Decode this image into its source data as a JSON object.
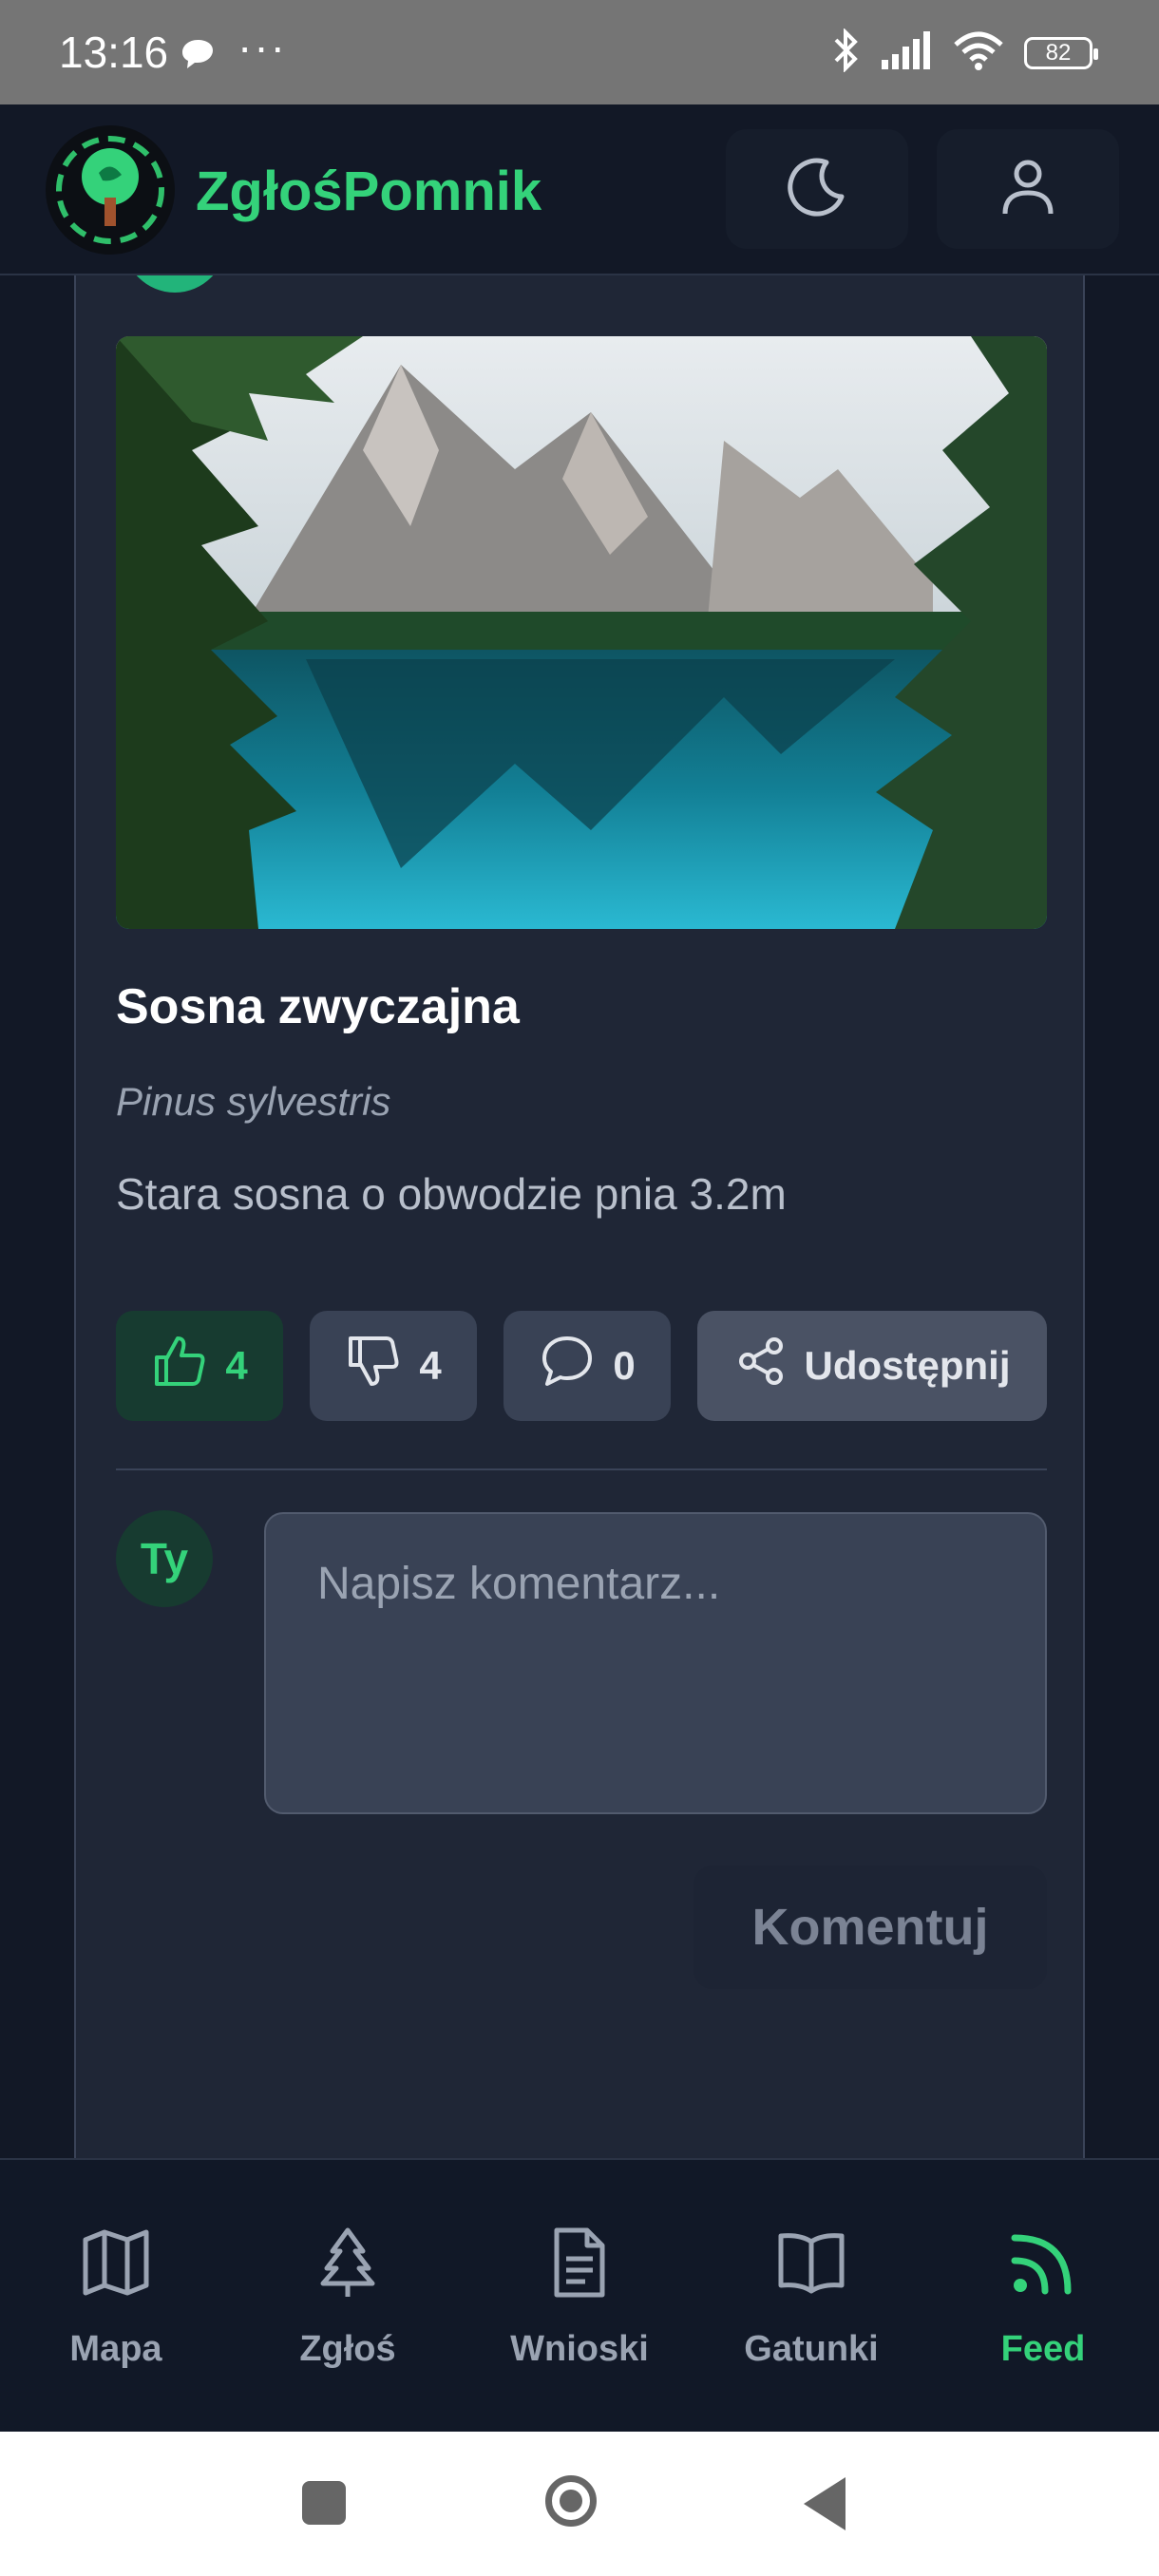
{
  "status_bar": {
    "time": "13:16",
    "dots": "···",
    "battery": "82"
  },
  "app": {
    "name": "ZgłośPomnik"
  },
  "post": {
    "title": "Sosna zwyczajna",
    "latin_name": "Pinus sylvestris",
    "description": "Stara sosna o obwodzie pnia 3.2m",
    "likes": "4",
    "dislikes": "4",
    "comments": "0",
    "share_label": "Udostępnij"
  },
  "comment_form": {
    "avatar_label": "Ty",
    "placeholder": "Napisz komentarz...",
    "submit_label": "Komentuj"
  },
  "nav": {
    "items": [
      {
        "label": "Mapa",
        "icon": "map-icon"
      },
      {
        "label": "Zgłoś",
        "icon": "tree-icon"
      },
      {
        "label": "Wnioski",
        "icon": "document-icon"
      },
      {
        "label": "Gatunki",
        "icon": "book-icon"
      },
      {
        "label": "Feed",
        "icon": "rss-icon"
      }
    ],
    "active": "Feed"
  },
  "colors": {
    "accent": "#34d27a",
    "background": "#121826",
    "card": "#1f2636"
  }
}
